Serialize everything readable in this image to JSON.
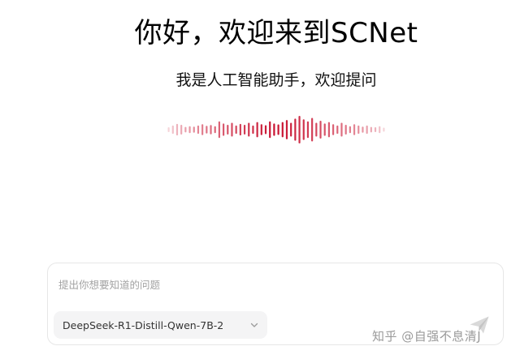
{
  "header": {
    "title": "你好，欢迎来到SCNet",
    "subtitle": "我是人工智能助手，欢迎提问"
  },
  "waveform": {
    "icon": "audio-waveform-icon",
    "accent_color": "#c8102e",
    "levels": [
      0.18,
      0.3,
      0.42,
      0.35,
      0.2,
      0.25,
      0.22,
      0.3,
      0.4,
      0.28,
      0.34,
      0.25,
      0.6,
      0.45,
      0.35,
      0.5,
      0.3,
      0.42,
      0.35,
      0.5,
      0.3,
      0.55,
      0.4,
      0.32,
      0.6,
      0.45,
      0.38,
      0.55,
      0.7,
      0.5,
      0.8,
      1.0,
      0.75,
      0.6,
      0.85,
      0.5,
      0.65,
      0.45,
      0.55,
      0.4,
      0.3,
      0.5,
      0.35,
      0.25,
      0.4,
      0.3,
      0.22,
      0.3,
      0.2,
      0.18,
      0.25,
      0.15
    ]
  },
  "composer": {
    "placeholder": "提出你想要知道的问题",
    "value": "",
    "model_selected": "DeepSeek-R1-Distill-Qwen-7B-2",
    "send_icon": "paper-plane-icon",
    "chevron_icon": "chevron-down-icon"
  },
  "watermark": {
    "text": "知乎 @自强不息清J"
  }
}
